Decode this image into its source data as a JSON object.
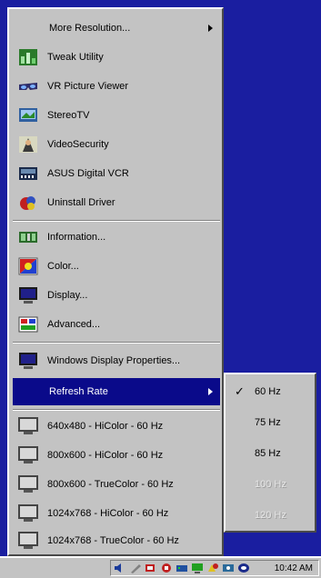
{
  "menu": {
    "items": [
      {
        "label": "More Resolution...",
        "icon": "none",
        "submenu": true
      },
      {
        "label": "Tweak Utility",
        "icon": "tweak-icon"
      },
      {
        "label": "VR Picture Viewer",
        "icon": "vr-glasses-icon"
      },
      {
        "label": "StereoTV",
        "icon": "stereo-tv-icon"
      },
      {
        "label": "VideoSecurity",
        "icon": "video-security-icon"
      },
      {
        "label": "ASUS Digital VCR",
        "icon": "vcr-icon"
      },
      {
        "label": "Uninstall Driver",
        "icon": "uninstall-icon"
      },
      {
        "label": "Information...",
        "icon": "information-icon"
      },
      {
        "label": "Color...",
        "icon": "color-icon"
      },
      {
        "label": "Display...",
        "icon": "display-icon"
      },
      {
        "label": "Advanced...",
        "icon": "advanced-icon"
      },
      {
        "label": "Windows Display Properties...",
        "icon": "monitor-icon"
      },
      {
        "label": "Refresh Rate",
        "icon": "none",
        "submenu": true,
        "highlighted": true
      },
      {
        "label": "640x480 - HiColor - 60 Hz",
        "icon": "monitor-icon"
      },
      {
        "label": "800x600 - HiColor - 60 Hz",
        "icon": "monitor-icon"
      },
      {
        "label": "800x600 - TrueColor - 60 Hz",
        "icon": "monitor-icon"
      },
      {
        "label": "1024x768 - HiColor - 60 Hz",
        "icon": "monitor-icon"
      },
      {
        "label": "1024x768 - TrueColor - 60 Hz",
        "icon": "monitor-icon"
      }
    ]
  },
  "submenu": {
    "items": [
      {
        "label": "60 Hz",
        "checked": true,
        "enabled": true
      },
      {
        "label": "75 Hz",
        "checked": false,
        "enabled": true
      },
      {
        "label": "85 Hz",
        "checked": false,
        "enabled": true
      },
      {
        "label": "100 Hz",
        "checked": false,
        "enabled": false
      },
      {
        "label": "120 Hz",
        "checked": false,
        "enabled": false
      }
    ],
    "check_glyph": "✓"
  },
  "taskbar": {
    "clock": "10:42 AM"
  },
  "colors": {
    "desktop": "#1a1ea0",
    "menu_bg": "#c3c3c3",
    "highlight": "#0a0a8a"
  }
}
